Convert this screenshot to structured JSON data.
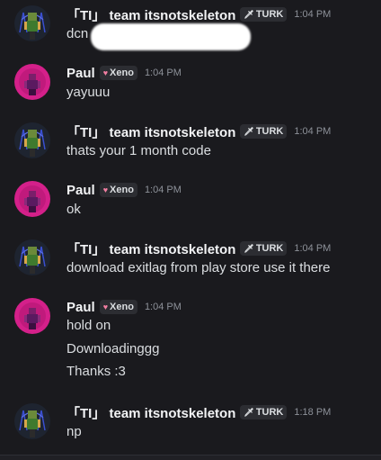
{
  "users": {
    "ti": {
      "name": "「TI」 team itsnotskeleton",
      "tag": "TURK",
      "tag_icon": "sword-icon",
      "tag_glyph": "🗡"
    },
    "paul": {
      "name": "Paul",
      "tag": "Xeno",
      "tag_icon": "heart-icon",
      "tag_glyph": "♥"
    }
  },
  "messages": [
    {
      "author": "ti",
      "time": "1:04 PM",
      "lines": [
        "dcn"
      ],
      "redacted": true
    },
    {
      "author": "paul",
      "time": "1:04 PM",
      "lines": [
        "yayuuu"
      ]
    },
    {
      "author": "ti",
      "time": "1:04 PM",
      "lines": [
        "thats your 1 month code"
      ]
    },
    {
      "author": "paul",
      "time": "1:04 PM",
      "lines": [
        "ok"
      ]
    },
    {
      "author": "ti",
      "time": "1:04 PM",
      "lines": [
        "download exitlag from play store use it there"
      ]
    },
    {
      "author": "paul",
      "time": "1:04 PM",
      "lines": [
        "hold on",
        "Downloadinggg",
        "Thanks :3"
      ]
    },
    {
      "author": "ti",
      "time": "1:18 PM",
      "lines": [
        "np"
      ]
    }
  ],
  "colors": {
    "background": "#1a1a1e",
    "username": "#f2f3f5",
    "text": "#dbdee1",
    "timestamp": "#8d9199",
    "paul_avatar": "#d4208a",
    "ti_avatar": "#1e2430"
  }
}
